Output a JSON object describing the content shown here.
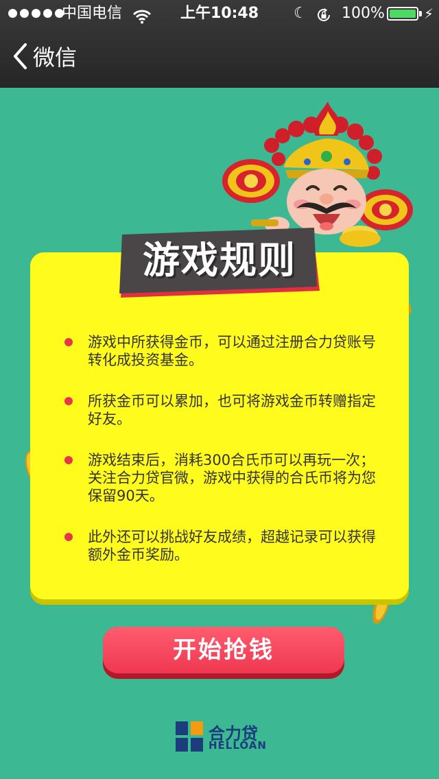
{
  "status_bar": {
    "carrier": "中国电信",
    "time": "上午10:48",
    "battery": "100%",
    "battery_level": 1.0,
    "icons": [
      "signal-dots-icon",
      "wifi-icon",
      "moon-icon",
      "rotation-lock-icon",
      "battery-icon",
      "charging-bolt-icon"
    ]
  },
  "nav": {
    "back_label": "微信",
    "back_icon": "chevron-left-icon"
  },
  "card": {
    "title": "游戏规则",
    "rules": [
      "游戏中所获得金币，可以通过注册合力贷账号转化成投资基金。",
      "所获金币可以累加，也可将游戏金币转赠指定好友。",
      "游戏结束后，消耗300合氏币可以再玩一次；关注合力贷官微，游戏中获得的合氏币将为您保留90天。",
      "此外还可以挑战好友成绩，超越记录可以获得额外金币奖励。"
    ]
  },
  "button": {
    "start_label": "开始抢钱"
  },
  "footer": {
    "logo_cn": "合力贷",
    "logo_en": "HELLOAN"
  },
  "colors": {
    "background": "#3cb893",
    "card": "#fffb1c",
    "button": "#ee3850",
    "bullet": "#e8354b",
    "brand": "#1c3d7c",
    "brand_accent": "#f39c12"
  }
}
